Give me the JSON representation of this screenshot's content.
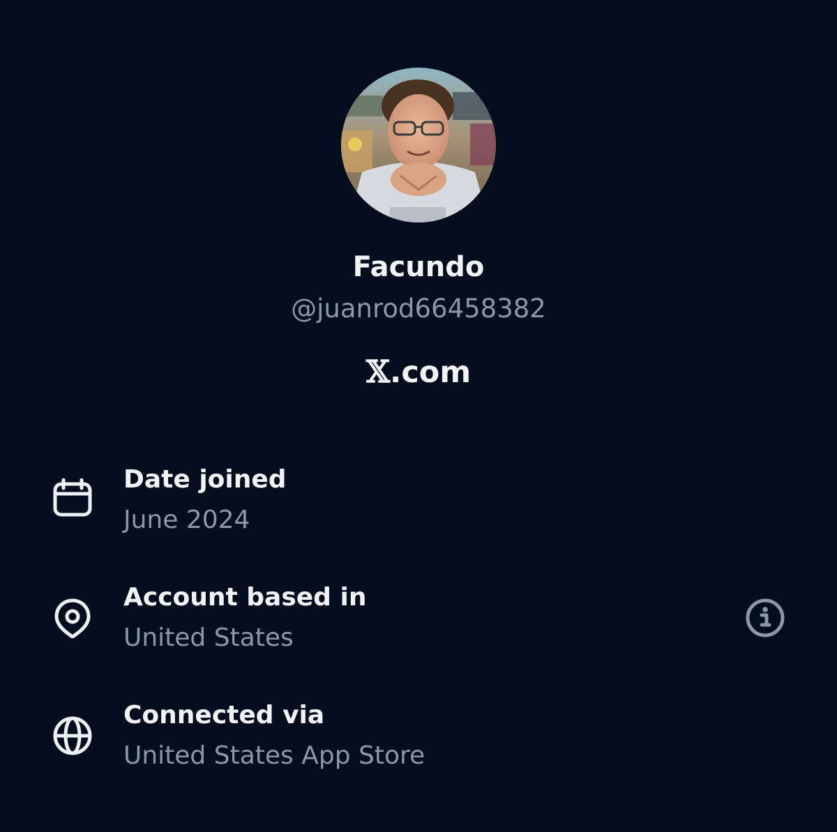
{
  "profile": {
    "display_name": "Facundo",
    "handle": "@juanrod66458382",
    "brand_glyph": "𝕏",
    "brand_suffix": ".com"
  },
  "about": [
    {
      "label": "Date joined",
      "value": "June 2024",
      "icon": "calendar-icon"
    },
    {
      "label": "Account based in",
      "value": "United States",
      "icon": "location-pin-icon",
      "has_info_button": true
    },
    {
      "label": "Connected via",
      "value": "United States App Store",
      "icon": "globe-icon"
    }
  ],
  "colors": {
    "background": "#030d1e",
    "primary_text": "#f1f3f5",
    "secondary_text": "#8b98a5"
  }
}
